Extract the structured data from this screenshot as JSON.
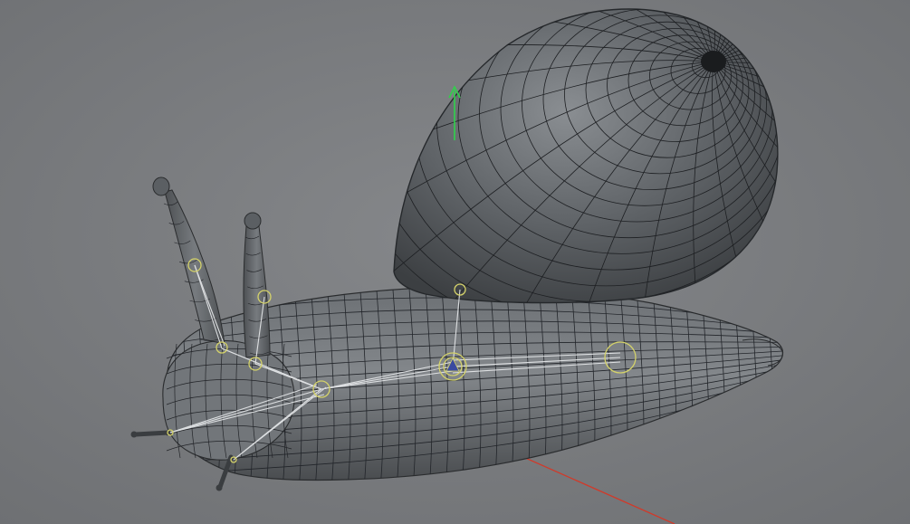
{
  "scene": {
    "subject": "snail",
    "background_color": "#7a7c7e",
    "mesh_color": "#5e6265",
    "wire_color": "#1d1f21",
    "joint_color": "#d4d26a",
    "bone_color": "#e6e8ea",
    "axis_y_color": "#2fd24a",
    "axis_x_color": "#d03a2a"
  }
}
